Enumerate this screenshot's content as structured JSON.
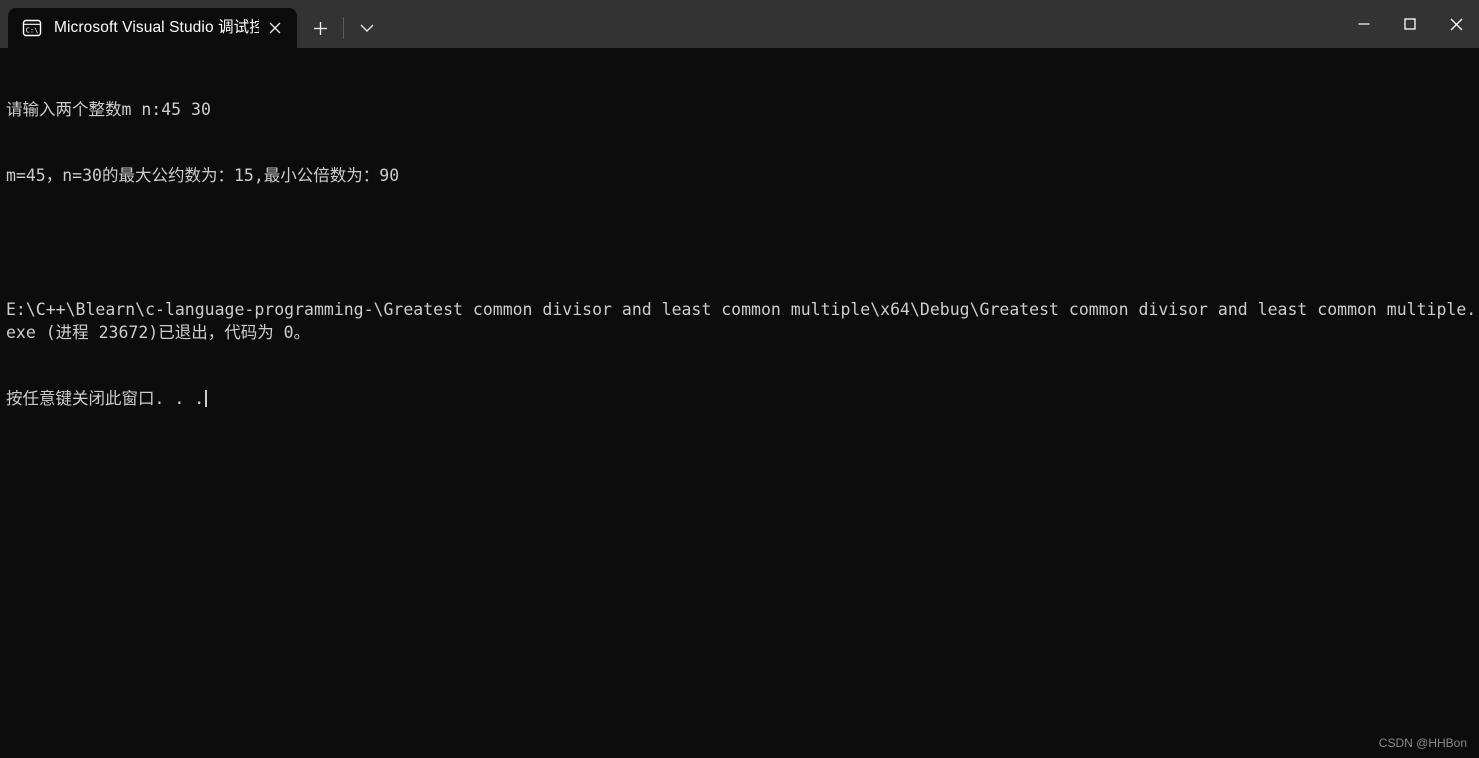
{
  "window": {
    "background_color": "#0c0c0c",
    "titlebar_color": "#333333",
    "text_color": "#cccccc"
  },
  "titlebar": {
    "tab": {
      "icon_name": "console-cmd-icon",
      "icon_glyph": "C:\\",
      "title": "Microsoft Visual Studio 调试控",
      "close_label": "✕"
    },
    "new_tab_label": "+",
    "dropdown_label": "⌄",
    "minimize_label": "─",
    "maximize_label": "□",
    "close_label": "✕"
  },
  "console": {
    "lines": [
      "请输入两个整数m n:45 30",
      "m=45，n=30的最大公约数为：15,最小公倍数为：90",
      "",
      "E:\\C++\\Blearn\\c-language-programming-\\Greatest common divisor and least common multiple\\x64\\Debug\\Greatest common divisor and least common multiple.exe (进程 23672)已退出，代码为 0。",
      "按任意键关闭此窗口. . ."
    ],
    "line1": "请输入两个整数m n:45 30",
    "line2": "m=45，n=30的最大公约数为：15,最小公倍数为：90",
    "line3": "",
    "line4": "E:\\C++\\Blearn\\c-language-programming-\\Greatest common divisor and least common multiple\\x64\\Debug\\Greatest common divisor and least common multiple.exe (进程 23672)已退出，代码为 0。",
    "line5": "按任意键关闭此窗口. . ."
  },
  "watermark": {
    "text": "CSDN @HHBon"
  }
}
